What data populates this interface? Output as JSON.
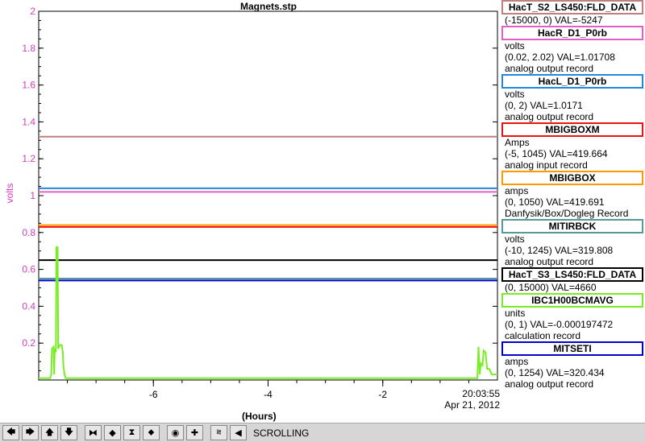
{
  "title": "Magnets.stp",
  "ylabel": "volts",
  "xlabel": "(Hours)",
  "time_line1": "20:03:55",
  "time_line2": "Apr 21, 2012",
  "chart_data": {
    "type": "line",
    "ylim": [
      0,
      2
    ],
    "xlim": [
      -8,
      0
    ],
    "yticks": [
      "2",
      "1.8",
      "1.6",
      "1.4",
      "1.2",
      "1",
      "0.8",
      "0.6",
      "0.4",
      "0.2"
    ],
    "ytick_values": [
      2,
      1.8,
      1.6,
      1.4,
      1.2,
      1,
      0.8,
      0.6,
      0.4,
      0.2
    ],
    "xticks": [
      "-6",
      "-4",
      "-2"
    ],
    "xtick_values": [
      -6,
      -4,
      -2
    ],
    "series": [
      {
        "name": "HacT_S2_LS450:FLD_DATA",
        "color": "#c08080",
        "y": 1.32
      },
      {
        "name": "HacR_D1_P0rb",
        "color": "#e060c8",
        "y": 1.02
      },
      {
        "name": "HacL_D1_P0rb",
        "color": "#2288dd",
        "y": 1.04
      },
      {
        "name": "MBIGBOXM",
        "color": "#ee1111",
        "y": 0.83
      },
      {
        "name": "MBIGBOX",
        "color": "#ff9900",
        "y": 0.84
      },
      {
        "name": "MITIRBCK",
        "color": "#559999",
        "y": 0.55
      },
      {
        "name": "HacT_S3_LS450:FLD_DATA",
        "color": "#000000",
        "y": 0.65
      },
      {
        "name": "MITSETI",
        "color": "#0000cc",
        "y": 0.54
      },
      {
        "name": "IBC1H00BCMAVG",
        "color": "#77ee22",
        "points": [
          [
            -8,
            0.01
          ],
          [
            -7.8,
            0.01
          ],
          [
            -7.78,
            0.03
          ],
          [
            -7.77,
            0.17
          ],
          [
            -7.74,
            0.18
          ],
          [
            -7.73,
            0.03
          ],
          [
            -7.72,
            0.17
          ],
          [
            -7.7,
            0.15
          ],
          [
            -7.69,
            0.72
          ],
          [
            -7.67,
            0.72
          ],
          [
            -7.66,
            0.17
          ],
          [
            -7.63,
            0.19
          ],
          [
            -7.6,
            0.19
          ],
          [
            -7.58,
            0.15
          ],
          [
            -7.57,
            0.08
          ],
          [
            -7.55,
            0.03
          ],
          [
            -7.53,
            0.01
          ],
          [
            -5,
            0.01
          ],
          [
            -3,
            0.01
          ],
          [
            -0.5,
            0.01
          ],
          [
            -0.35,
            0.01
          ],
          [
            -0.33,
            0.18
          ],
          [
            -0.31,
            0.03
          ],
          [
            -0.29,
            0.09
          ],
          [
            -0.26,
            0.08
          ],
          [
            -0.24,
            0.16
          ],
          [
            -0.21,
            0.15
          ],
          [
            -0.18,
            0.06
          ],
          [
            -0.14,
            0.06
          ],
          [
            -0.1,
            0.03
          ],
          [
            0,
            0.03
          ]
        ]
      }
    ]
  },
  "legend": [
    {
      "name": "HacT_S2_LS450:FLD_DATA",
      "color": "#c08080",
      "lines": [
        "(-15000, 0) VAL=-5247"
      ]
    },
    {
      "name": "HacR_D1_P0rb",
      "color": "#e060c8",
      "lines": [
        "volts",
        "(0.02, 2.02) VAL=1.01708",
        "analog output record"
      ]
    },
    {
      "name": "HacL_D1_P0rb",
      "color": "#2288dd",
      "lines": [
        "volts",
        "(0, 2) VAL=1.0171",
        "analog output record"
      ]
    },
    {
      "name": "MBIGBOXM",
      "color": "#ee1111",
      "lines": [
        "Amps",
        "(-5, 1045) VAL=419.664",
        "analog input record"
      ]
    },
    {
      "name": "MBIGBOX",
      "color": "#ff9900",
      "lines": [
        "amps",
        "(0, 1050) VAL=419.691",
        "Danfysik/Box/Dogleg Record"
      ]
    },
    {
      "name": "MITIRBCK",
      "color": "#559999",
      "lines": [
        "volts",
        "(-10, 1245) VAL=319.808",
        "analog output record"
      ]
    },
    {
      "name": "HacT_S3_LS450:FLD_DATA",
      "color": "#000000",
      "lines": [
        "(0, 15000) VAL=4660"
      ]
    },
    {
      "name": "IBC1H00BCMAVG",
      "color": "#77ee22",
      "lines": [
        "units",
        "(0, 1) VAL=-0.000197472",
        "calculation record"
      ]
    },
    {
      "name": "MITSETI",
      "color": "#0000cc",
      "lines": [
        "amps",
        "(0, 1254) VAL=320.434",
        "analog output record"
      ]
    }
  ],
  "toolbar": {
    "buttons": [
      {
        "name": "scroll-left-button",
        "glyph": "🡄"
      },
      {
        "name": "scroll-right-button",
        "glyph": "🡆"
      },
      {
        "name": "scroll-up-button",
        "glyph": "🡅"
      },
      {
        "name": "scroll-down-button",
        "glyph": "🡇"
      },
      {
        "name": "zoom-in-x-button",
        "glyph": "⧓"
      },
      {
        "name": "zoom-out-x-button",
        "glyph": "◆"
      },
      {
        "name": "zoom-in-y-button",
        "glyph": "⧗"
      },
      {
        "name": "zoom-out-y-button",
        "glyph": "⬥"
      },
      {
        "name": "autoscale-button",
        "glyph": "◉"
      },
      {
        "name": "crosshair-button",
        "glyph": "✚"
      },
      {
        "name": "stagger-button",
        "glyph": "⩬"
      },
      {
        "name": "pause-button",
        "glyph": "◀"
      }
    ],
    "status": "SCROLLING"
  }
}
